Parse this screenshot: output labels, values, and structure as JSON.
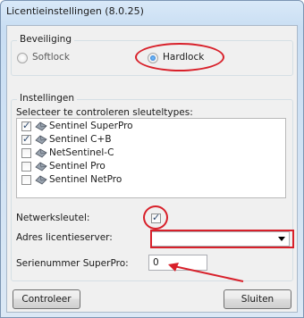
{
  "window": {
    "title": "Licentieinstellingen (8.0.25)"
  },
  "security_group": {
    "title": "Beveiliging",
    "options": [
      {
        "label": "Softlock",
        "selected": false
      },
      {
        "label": "Hardlock",
        "selected": true
      }
    ]
  },
  "settings_group": {
    "title": "Instellingen",
    "list_label": "Selecteer te controleren sleuteltypes:",
    "key_types": [
      {
        "label": "Sentinel SuperPro",
        "checked": true,
        "icon": "key-icon"
      },
      {
        "label": "Sentinel C+B",
        "checked": true,
        "icon": "key-icon"
      },
      {
        "label": "NetSentinel-C",
        "checked": false,
        "icon": "key-icon"
      },
      {
        "label": "Sentinel Pro",
        "checked": false,
        "icon": "key-icon"
      },
      {
        "label": "Sentinel NetPro",
        "checked": false,
        "icon": "key-icon"
      }
    ],
    "network_key": {
      "label": "Netwerksleutel:",
      "checked": true
    },
    "license_server": {
      "label": "Adres licentieserver:",
      "value": ""
    },
    "serial_number": {
      "label": "Serienummer SuperPro:",
      "value": "0"
    }
  },
  "buttons": {
    "check": "Controleer",
    "close": "Sluiten"
  },
  "annotation_color": "#d8202a"
}
